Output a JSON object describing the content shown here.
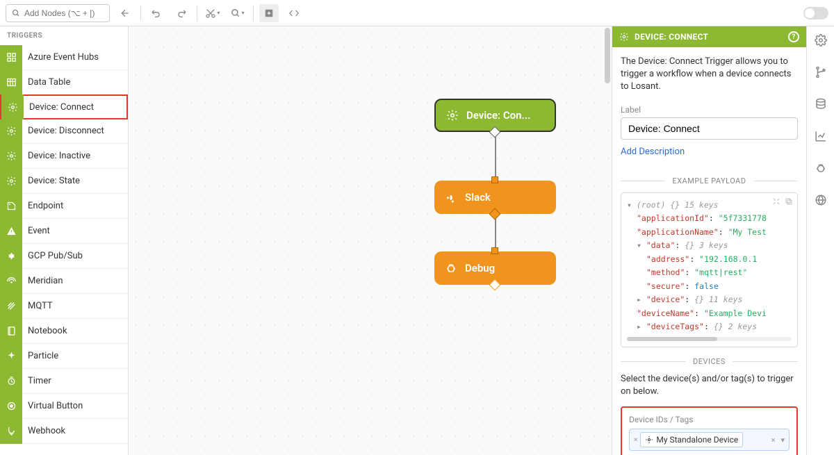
{
  "toolbar": {
    "search_placeholder": "Add Nodes (⌥ + [)"
  },
  "palette": {
    "header": "TRIGGERS",
    "items": [
      {
        "icon": "hubs",
        "label": "Azure Event Hubs"
      },
      {
        "icon": "table",
        "label": "Data Table"
      },
      {
        "icon": "gear",
        "label": "Device: Connect",
        "selected": true
      },
      {
        "icon": "gear",
        "label": "Device: Disconnect"
      },
      {
        "icon": "gear",
        "label": "Device: Inactive"
      },
      {
        "icon": "gear",
        "label": "Device: State"
      },
      {
        "icon": "tag",
        "label": "Endpoint"
      },
      {
        "icon": "warn",
        "label": "Event"
      },
      {
        "icon": "cloud",
        "label": "GCP Pub/Sub"
      },
      {
        "icon": "wifi",
        "label": "Meridian"
      },
      {
        "icon": "stripes",
        "label": "MQTT"
      },
      {
        "icon": "book",
        "label": "Notebook"
      },
      {
        "icon": "spark",
        "label": "Particle"
      },
      {
        "icon": "clock",
        "label": "Timer"
      },
      {
        "icon": "circle",
        "label": "Virtual Button"
      },
      {
        "icon": "hook",
        "label": "Webhook"
      }
    ]
  },
  "canvas": {
    "nodes": [
      {
        "label": "Device: Con...",
        "type": "trigger"
      },
      {
        "label": "Slack",
        "type": "action"
      },
      {
        "label": "Debug",
        "type": "debug"
      }
    ]
  },
  "panel": {
    "title": "DEVICE: CONNECT",
    "description": "The Device: Connect Trigger allows you to trigger a workflow when a device connects to Losant.",
    "label_field": "Label",
    "label_value": "Device: Connect",
    "add_desc": "Add Description",
    "example_header": "EXAMPLE PAYLOAD",
    "payload": {
      "root_note": "15 keys",
      "applicationId": "\"5f7331778",
      "applicationName": "\"My Test",
      "data_note": "3 keys",
      "address": "\"192.168.0.1",
      "method": "\"mqtt|rest\"",
      "secure": "false",
      "device_note": "11 keys",
      "deviceName": "\"Example Devi",
      "deviceTags_note": "2 keys"
    },
    "devices_header": "DEVICES",
    "devices_desc": "Select the device(s) and/or tag(s) to trigger on below.",
    "device_ids_label": "Device IDs / Tags",
    "device_chip": "My Standalone Device"
  }
}
